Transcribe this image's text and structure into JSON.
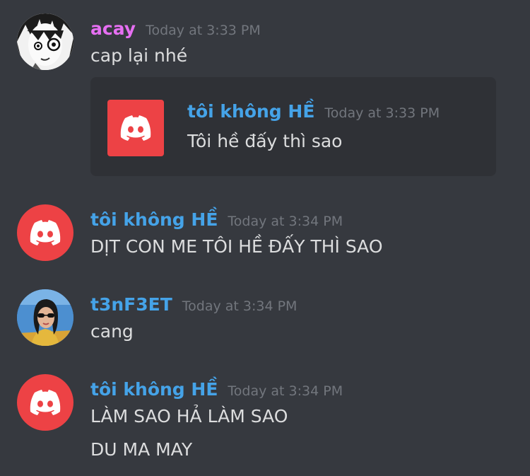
{
  "messages": [
    {
      "author": "acay",
      "author_color": "#e66ff2",
      "timestamp": "Today at 3:33 PM",
      "lines": [
        "cap lại nhé"
      ],
      "avatar": "manga-face-avatar",
      "embed": {
        "author": "tôi không HỀ",
        "author_color": "#45a3e8",
        "timestamp": "Today at 3:33 PM",
        "text": "Tôi hề đấy thì sao",
        "icon": "discord-logo-icon"
      }
    },
    {
      "author": "tôi không HỀ",
      "author_color": "#45a3e8",
      "timestamp": "Today at 3:34 PM",
      "lines": [
        "DỊT CON ME TÔI HỀ ĐẤY THÌ SAO"
      ],
      "avatar": "discord-logo-icon"
    },
    {
      "author": "t3nF3ET",
      "author_color": "#45a3e8",
      "timestamp": "Today at 3:34 PM",
      "lines": [
        "cang"
      ],
      "avatar": "photo-avatar"
    },
    {
      "author": "tôi không HỀ",
      "author_color": "#45a3e8",
      "timestamp": "Today at 3:34 PM",
      "lines": [
        "LÀM SAO HẢ LÀM SAO",
        "DU MA MAY"
      ],
      "avatar": "discord-logo-icon"
    }
  ],
  "colors": {
    "background": "#36393f",
    "embed_background": "#2f3136",
    "discord_red": "#ed4245",
    "timestamp": "#72767d",
    "text": "#dcddde"
  }
}
